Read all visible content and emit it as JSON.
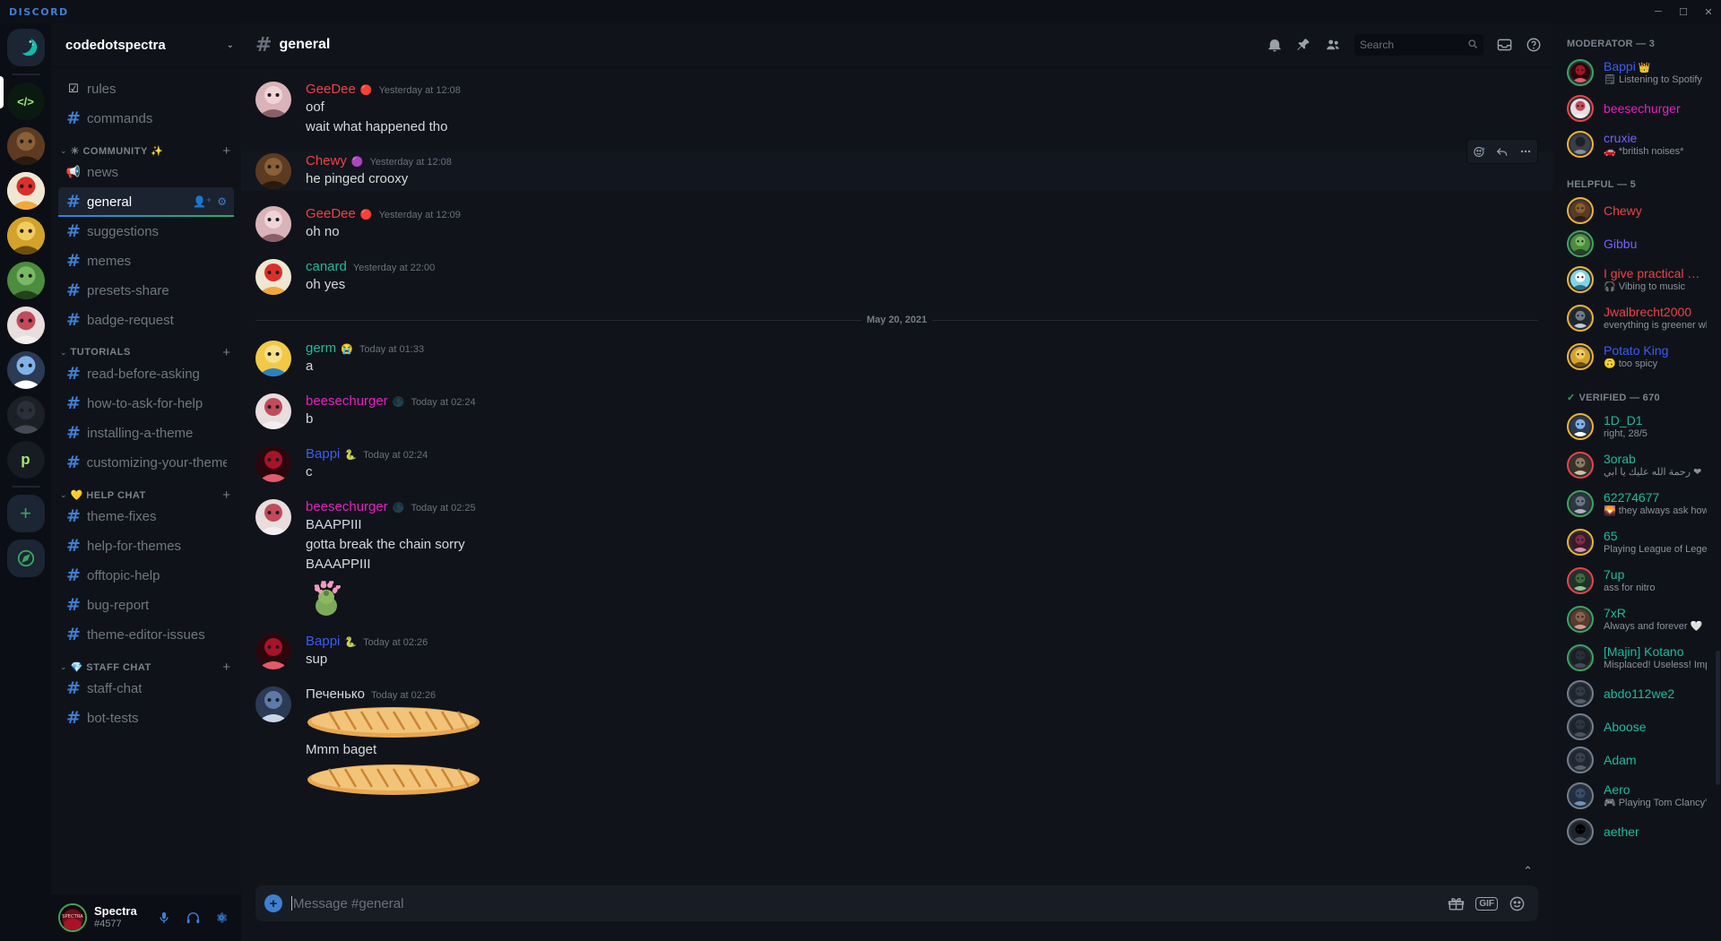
{
  "titlebar": {
    "wordmark": "DISCORD",
    "minimize": "─",
    "maximize": "☐",
    "close": "✕"
  },
  "guild_rail": {
    "home_label": "home-button",
    "items": [
      {
        "name": "home",
        "initial": "",
        "color": "#1b2533",
        "active": false
      },
      {
        "name": "spectra-theme",
        "initial": "</>",
        "color": "#0a1a10",
        "active": true
      },
      {
        "name": "chewy-server",
        "initial": "",
        "color": "#6b5136",
        "active": false
      },
      {
        "name": "red-chat",
        "initial": "",
        "color": "#f2f2f2",
        "active": false
      },
      {
        "name": "cat-server",
        "initial": "",
        "color": "#c9a37a",
        "active": false
      },
      {
        "name": "frog-server",
        "initial": "",
        "color": "#0f2a15",
        "active": false
      },
      {
        "name": "pink-server",
        "initial": "",
        "color": "#7d2338",
        "active": false
      },
      {
        "name": "anime-server",
        "initial": "",
        "color": "#244a55",
        "active": false
      },
      {
        "name": "yinyang-server",
        "initial": "",
        "color": "#2a2f38",
        "active": false
      },
      {
        "name": "p-server",
        "initial": "p",
        "color": "#161b24",
        "active": false
      }
    ],
    "add_server": "+",
    "explore": "⧉"
  },
  "sidebar": {
    "guild_name": "codedotspectra",
    "chevron": "⌄",
    "top_channels": [
      {
        "icon": "☑",
        "icon_name": "rules-icon",
        "label": "rules",
        "type": "rules"
      },
      {
        "icon": "#",
        "icon_name": "hash-icon",
        "label": "commands",
        "type": "text"
      }
    ],
    "categories": [
      {
        "label": "☀ COMMUNITY ✨",
        "plus": "+",
        "chevron": "⌄",
        "channels": [
          {
            "icon": "📢",
            "icon_name": "announcement-icon",
            "label": "news",
            "type": "news"
          },
          {
            "icon": "#",
            "icon_name": "hash-icon",
            "label": "general",
            "type": "text",
            "active": true,
            "actions": [
              "👤⁺",
              "⚙"
            ]
          },
          {
            "icon": "#",
            "icon_name": "hash-icon",
            "label": "suggestions",
            "type": "text"
          },
          {
            "icon": "#",
            "icon_name": "hash-icon",
            "label": "memes",
            "type": "text"
          },
          {
            "icon": "#",
            "icon_name": "hash-icon",
            "label": "presets-share",
            "type": "text"
          },
          {
            "icon": "#",
            "icon_name": "hash-icon",
            "label": "badge-request",
            "type": "text"
          }
        ]
      },
      {
        "label": "TUTORIALS",
        "plus": "+",
        "chevron": "⌄",
        "channels": [
          {
            "icon": "#",
            "icon_name": "hash-icon",
            "label": "read-before-asking",
            "type": "text"
          },
          {
            "icon": "#",
            "icon_name": "hash-icon",
            "label": "how-to-ask-for-help",
            "type": "text"
          },
          {
            "icon": "#",
            "icon_name": "hash-icon",
            "label": "installing-a-theme",
            "type": "text"
          },
          {
            "icon": "#",
            "icon_name": "hash-icon",
            "label": "customizing-your-theme",
            "type": "text"
          }
        ]
      },
      {
        "label": "💛 HELP CHAT",
        "plus": "+",
        "chevron": "⌄",
        "channels": [
          {
            "icon": "#",
            "icon_name": "hash-icon",
            "label": "theme-fixes",
            "type": "text"
          },
          {
            "icon": "#",
            "icon_name": "hash-icon",
            "label": "help-for-themes",
            "type": "text"
          },
          {
            "icon": "#",
            "icon_name": "hash-icon",
            "label": "offtopic-help",
            "type": "text"
          },
          {
            "icon": "#",
            "icon_name": "hash-icon",
            "label": "bug-report",
            "type": "text"
          },
          {
            "icon": "#",
            "icon_name": "hash-icon",
            "label": "theme-editor-issues",
            "type": "text"
          }
        ]
      },
      {
        "label": "💎 STAFF CHAT",
        "plus": "+",
        "chevron": "⌄",
        "channels": [
          {
            "icon": "#",
            "icon_name": "hash-icon",
            "label": "staff-chat",
            "type": "private"
          },
          {
            "icon": "#",
            "icon_name": "hash-icon",
            "label": "bot-tests",
            "type": "text"
          }
        ]
      }
    ]
  },
  "user_panel": {
    "name": "Spectra",
    "tag": "#4577",
    "mic_icon": "🎤",
    "headphones_icon": "🎧",
    "settings_icon": "⚙"
  },
  "chat_header": {
    "hash": "#",
    "channel": "general",
    "icons": [
      {
        "name": "notification-bell-icon",
        "glyph": "🔔"
      },
      {
        "name": "pinned-messages-icon",
        "glyph": "📌"
      },
      {
        "name": "member-list-icon",
        "glyph": "👥"
      }
    ],
    "search_placeholder": "Search",
    "search_icon": "🔍",
    "inbox_icon": "📥",
    "help_icon": "?"
  },
  "messages": [
    {
      "author": "GeeDee",
      "color": "#ed4245",
      "badge": "🔴",
      "badge_name": "verified-bot-badge",
      "time": "Yesterday at 12:08",
      "lines": [
        "oof",
        "wait what happened tho"
      ],
      "avatar": "geedee-avatar"
    },
    {
      "author": "Chewy",
      "color": "#ed4245",
      "badge": "🟣",
      "badge_name": "boost-badge",
      "time": "Yesterday at 12:08",
      "lines": [
        "he pinged crooxy"
      ],
      "avatar": "chewy-avatar",
      "hovered": true
    },
    {
      "author": "GeeDee",
      "color": "#ed4245",
      "badge": "🔴",
      "badge_name": "verified-bot-badge",
      "time": "Yesterday at 12:09",
      "lines": [
        "oh no"
      ],
      "avatar": "geedee-avatar"
    },
    {
      "author": "canard",
      "color": "#1abc9c",
      "badge": "",
      "badge_name": "",
      "time": "Yesterday at 22:00",
      "lines": [
        "oh yes"
      ],
      "avatar": "canard-avatar"
    }
  ],
  "date_divider": "May 20, 2021",
  "messages_after": [
    {
      "author": "germ",
      "color": "#1abc9c",
      "badge": "😭",
      "badge_name": "crying-emoji-badge",
      "time": "Today at 01:33",
      "lines": [
        "a"
      ],
      "avatar": "germ-avatar"
    },
    {
      "author": "beesechurger",
      "color": "#e91ec4",
      "badge": "🌑",
      "badge_name": "moon-badge",
      "time": "Today at 02:24",
      "lines": [
        "b"
      ],
      "avatar": "beese-avatar"
    },
    {
      "author": "Bappi",
      "color": "#3c5cf5",
      "badge": "🐍",
      "badge_name": "snake-badge",
      "time": "Today at 02:24",
      "lines": [
        "c"
      ],
      "avatar": "bappi-avatar"
    },
    {
      "author": "beesechurger",
      "color": "#e91ec4",
      "badge": "🌑",
      "badge_name": "moon-badge",
      "time": "Today at 02:25",
      "lines": [
        "BAAPPIII",
        "gotta break the chain sorry",
        "BAAAPPIII"
      ],
      "emoji_image": "kermit-hearts-emoji",
      "avatar": "beese-avatar"
    },
    {
      "author": "Bappi",
      "color": "#3c5cf5",
      "badge": "🐍",
      "badge_name": "snake-badge",
      "time": "Today at 02:26",
      "lines": [
        "sup"
      ],
      "avatar": "bappi-avatar"
    },
    {
      "author": "Печенько",
      "color": "#d6d8db",
      "badge": "",
      "badge_name": "",
      "time": "Today at 02:26",
      "lines": [],
      "attachments": [
        "baguette-image",
        "Mmm baget",
        "baguette-image"
      ],
      "avatar": "pechenko-avatar"
    }
  ],
  "composer": {
    "plus": "+",
    "placeholder": "Message #general",
    "gift_icon": "🎁",
    "gif_label": "GIF",
    "sticker_icon": "🎴",
    "emoji_icon": "🙂",
    "jump_to_present": "⌃"
  },
  "members": {
    "groups": [
      {
        "label": "MODERATOR — 3",
        "check": "",
        "people": [
          {
            "name": "Bappi",
            "color": "#3c5cf5",
            "status": "Listening to Spotify",
            "status_icon": "🗒",
            "crown": "👑",
            "ring": "#3ba55d",
            "av": "bappi"
          },
          {
            "name": "beesechurger",
            "color": "#e91ec4",
            "status": "",
            "status_icon": "",
            "crown": "",
            "ring": "#ed4245",
            "av": "beese"
          },
          {
            "name": "cruxie",
            "color": "#7b5cff",
            "status": "*british noises*",
            "status_icon": "🚗",
            "crown": "",
            "ring": "#f0b232",
            "av": "cruxie"
          }
        ]
      },
      {
        "label": "HELPFUL — 5",
        "check": "",
        "people": [
          {
            "name": "Chewy",
            "color": "#ed4245",
            "status": "",
            "status_icon": "",
            "crown": "",
            "ring": "#f0b232",
            "av": "chewy"
          },
          {
            "name": "Gibbu",
            "color": "#7b5cff",
            "status": "",
            "status_icon": "",
            "crown": "",
            "ring": "#3ba55d",
            "av": "gibbu"
          },
          {
            "name": "I give practical advice",
            "color": "#ed4245",
            "status": "Vibing to music",
            "status_icon": "🎧",
            "crown": "",
            "ring": "#f0b232",
            "av": "advice"
          },
          {
            "name": "Jwalbrecht2000",
            "color": "#ed4245",
            "status": "everything is greener when ev…",
            "status_icon": "",
            "crown": "",
            "ring": "#f0b232",
            "av": "jwal"
          },
          {
            "name": "Potato King",
            "color": "#3c5cf5",
            "status": "too spicy",
            "status_icon": "🙃",
            "crown": "",
            "ring": "#f0b232",
            "av": "potato"
          }
        ]
      },
      {
        "label": "VERIFIED — 670",
        "check": "✓",
        "people": [
          {
            "name": "1D_D1",
            "color": "#1abc9c",
            "status": "right, 28/5",
            "status_icon": "",
            "crown": "",
            "ring": "#f0b232",
            "av": "1dd1"
          },
          {
            "name": "3orab",
            "color": "#1abc9c",
            "status": "رحمة الله عليك يا أبي ❤",
            "status_icon": "",
            "crown": "",
            "ring": "#ed4245",
            "av": "3orab"
          },
          {
            "name": "62274677",
            "color": "#1abc9c",
            "status": "they always ask how its ma…",
            "status_icon": "🌄",
            "crown": "",
            "ring": "#3ba55d",
            "av": "622"
          },
          {
            "name": "65",
            "color": "#1abc9c",
            "status": "Playing League of Legends",
            "status_icon": "",
            "crown": "",
            "ring": "#f0b232",
            "av": "65"
          },
          {
            "name": "7up",
            "color": "#1abc9c",
            "status": "ass for nitro",
            "status_icon": "",
            "crown": "",
            "ring": "#ed4245",
            "av": "7up"
          },
          {
            "name": "7xR",
            "color": "#1abc9c",
            "status": "Always and forever 🤍",
            "status_icon": "",
            "crown": "",
            "ring": "#3ba55d",
            "av": "7xr"
          },
          {
            "name": "[Majin] Kotano",
            "color": "#1abc9c",
            "status": "Misplaced! Useless! Implausib…",
            "status_icon": "",
            "crown": "",
            "ring": "#3ba55d",
            "av": "majin"
          },
          {
            "name": "abdo112we2",
            "color": "#1abc9c",
            "status": "",
            "status_icon": "",
            "crown": "",
            "ring": "#747f8d",
            "av": "abdo"
          },
          {
            "name": "Aboose",
            "color": "#1abc9c",
            "status": "",
            "status_icon": "",
            "crown": "",
            "ring": "#747f8d",
            "av": "aboose"
          },
          {
            "name": "Adam",
            "color": "#1abc9c",
            "status": "",
            "status_icon": "",
            "crown": "",
            "ring": "#747f8d",
            "av": "adam"
          },
          {
            "name": "Aero",
            "color": "#1abc9c",
            "status": "Playing Tom Clancy's The …",
            "status_icon": "🎮",
            "crown": "",
            "ring": "#747f8d",
            "av": "aero"
          },
          {
            "name": "aether",
            "color": "#1abc9c",
            "status": "",
            "status_icon": "",
            "crown": "",
            "ring": "#747f8d",
            "av": "aether"
          }
        ]
      }
    ]
  },
  "hover_toolbar": {
    "add_reaction": "😊⁺",
    "reply": "↩",
    "more": "⋯"
  },
  "colors": {
    "accent": "#3e7fd4",
    "online": "#3ba55d",
    "bg_deep": "#0b0e14",
    "bg_sidebar": "#0f1319",
    "bg_chat": "#10131a"
  }
}
